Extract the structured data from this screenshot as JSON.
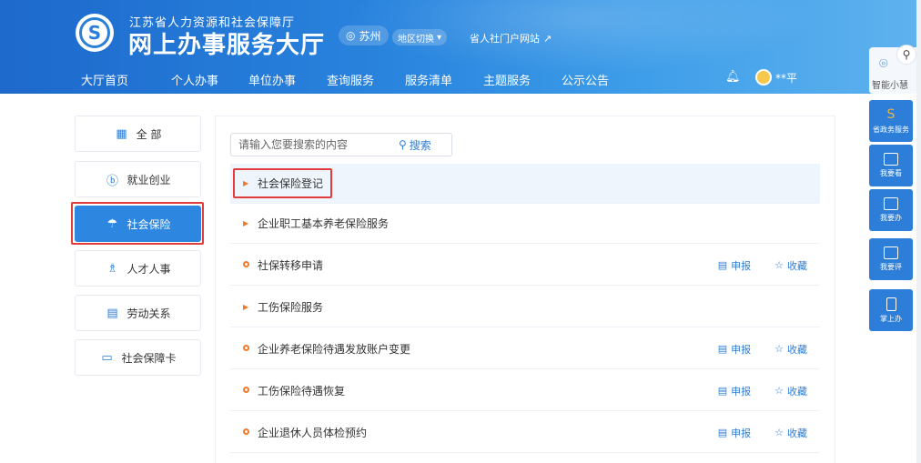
{
  "header": {
    "org_name": "江苏省人力资源和社会保障厅",
    "site_title": "网上办事服务大厅",
    "city": "苏州",
    "region_switch": "地区切换",
    "portal_link": "省人社门户网站",
    "user_name": "**平"
  },
  "nav": {
    "items": [
      {
        "label": "大厅首页"
      },
      {
        "label": "个人办事"
      },
      {
        "label": "单位办事"
      },
      {
        "label": "查询服务"
      },
      {
        "label": "服务清单"
      },
      {
        "label": "主题服务"
      },
      {
        "label": "公示公告"
      }
    ],
    "active_index": 1
  },
  "sidebar": {
    "items": [
      {
        "label": "全 部",
        "icon": "grid-icon"
      },
      {
        "label": "就业创业",
        "icon": "employment-icon"
      },
      {
        "label": "社会保险",
        "icon": "umbrella-icon"
      },
      {
        "label": "人才人事",
        "icon": "people-icon"
      },
      {
        "label": "劳动关系",
        "icon": "document-icon"
      },
      {
        "label": "社会保障卡",
        "icon": "card-icon"
      }
    ],
    "active_index": 2
  },
  "search": {
    "placeholder": "请输入您要搜索的内容",
    "button_label": "搜索"
  },
  "services": {
    "rows": [
      {
        "label": "社会保险登记",
        "kind": "category",
        "highlighted": true
      },
      {
        "label": "企业职工基本养老保险服务",
        "kind": "category"
      },
      {
        "label": "社保转移申请",
        "kind": "item",
        "apply": "申报",
        "favorite": "收藏"
      },
      {
        "label": "工伤保险服务",
        "kind": "category"
      },
      {
        "label": "企业养老保险待遇发放账户变更",
        "kind": "item",
        "apply": "申报",
        "favorite": "收藏"
      },
      {
        "label": "工伤保险待遇恢复",
        "kind": "item",
        "apply": "申报",
        "favorite": "收藏"
      },
      {
        "label": "企业退休人员体检预约",
        "kind": "item",
        "apply": "申报",
        "favorite": "收藏"
      }
    ]
  },
  "right_rail": {
    "assistant_label": "智能小慧",
    "buttons": [
      {
        "label": "省政务服务",
        "color": "#2d7ed8"
      },
      {
        "label": "我要看",
        "color": "#2d7ed8"
      },
      {
        "label": "我要办",
        "color": "#2d7ed8"
      },
      {
        "label": "我要评",
        "color": "#2d7ed8"
      },
      {
        "label": "掌上办",
        "color": "#2d7ed8"
      }
    ]
  },
  "colors": {
    "primary": "#2d7ed8",
    "highlight_border": "#e23b3b",
    "marker": "#f07a2c"
  }
}
